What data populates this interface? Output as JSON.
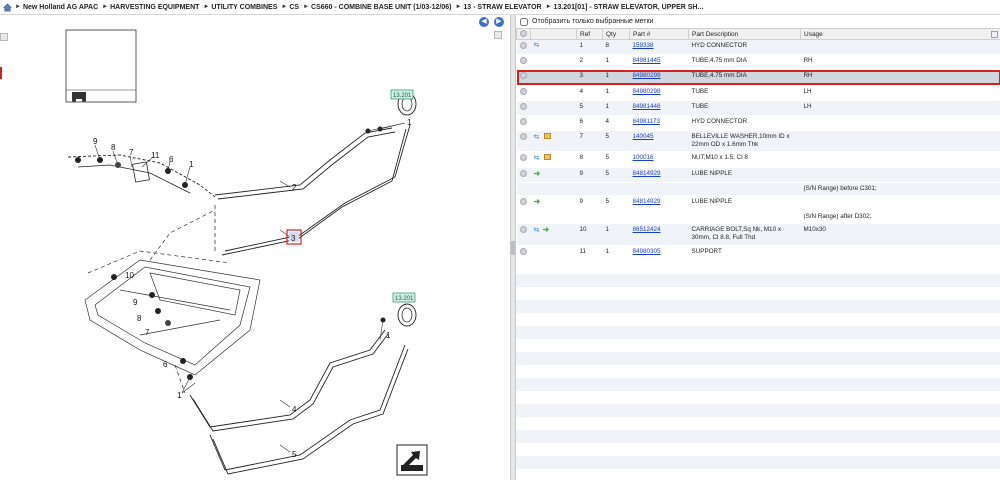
{
  "breadcrumb": {
    "items": [
      "New Holland AG APAC",
      "HARVESTING EQUIPMENT",
      "UTILITY COMBINES",
      "CS",
      "CS660 - COMBINE BASE UNIT (1/03-12/06)",
      "13 - STRAW ELEVATOR",
      "13.201[01] - STRAW ELEVATOR, UPPER SH..."
    ]
  },
  "diagram": {
    "ref_box_top": "13.201",
    "ref_box_bottom": "13.201",
    "callouts": [
      "1",
      "2",
      "3",
      "4",
      "5",
      "6",
      "7",
      "8",
      "9",
      "10",
      "11",
      "1",
      "1",
      "1",
      "6",
      "7",
      "8",
      "9",
      "10"
    ]
  },
  "filter": {
    "label": "Отобразить только выбранные метки"
  },
  "table": {
    "headers": [
      "Ref",
      "Qty",
      "Part #",
      "Part Description",
      "Usage"
    ],
    "rows": [
      {
        "ref": "1",
        "qty": "8",
        "part": "159338",
        "desc": "HYD CONNECTOR",
        "usage": "",
        "icons": [
          "swap"
        ]
      },
      {
        "ref": "2",
        "qty": "1",
        "part": "84981445",
        "desc": "TUBE,4.75 mm DIA",
        "usage": "RH",
        "icons": []
      },
      {
        "ref": "3",
        "qty": "1",
        "part": "84980299",
        "desc": "TUBE,4.75 mm DIA",
        "usage": "RH",
        "icons": [],
        "selected": true
      },
      {
        "ref": "4",
        "qty": "1",
        "part": "84980298",
        "desc": "TUBE",
        "usage": "LH",
        "icons": []
      },
      {
        "ref": "5",
        "qty": "1",
        "part": "84981446",
        "desc": "TUBE",
        "usage": "LH",
        "icons": []
      },
      {
        "ref": "6",
        "qty": "4",
        "part": "84981173",
        "desc": "HYD CONNECTOR",
        "usage": "",
        "icons": []
      },
      {
        "ref": "7",
        "qty": "5",
        "part": "140045",
        "desc": "BELLEVILLE WASHER,10mm ID x 22mm OD x 1.6mm Thk",
        "usage": "",
        "icons": [
          "swap",
          "box"
        ]
      },
      {
        "ref": "8",
        "qty": "5",
        "part": "100016",
        "desc": "NUT,M10 x 1.5, Cl 8",
        "usage": "",
        "icons": [
          "swap",
          "box"
        ]
      },
      {
        "ref": "9",
        "qty": "5",
        "part": "84814929",
        "desc": "LUBE NIPPLE",
        "usage": "",
        "icons": [
          "arrow"
        ],
        "note": "(S/N Range) before C301;"
      },
      {
        "ref": "9",
        "qty": "5",
        "part": "84814929",
        "desc": "LUBE NIPPLE",
        "usage": "",
        "icons": [
          "arrow"
        ],
        "note": "(S/N Range) after D302;"
      },
      {
        "ref": "10",
        "qty": "1",
        "part": "86512424",
        "desc": "CARRIAGE BOLT,Sq Nk, M10 x 30mm, Cl 8.8, Full Thd",
        "usage": "M10x30",
        "icons": [
          "swap",
          "arrow"
        ]
      },
      {
        "ref": "11",
        "qty": "1",
        "part": "84980305",
        "desc": "SUPPORT",
        "usage": "",
        "icons": []
      }
    ]
  },
  "colors": {
    "accent_blue": "#3a72c6",
    "selection_red": "#d62020",
    "link": "#1a3fcc",
    "callout_bg": "#cfeee4"
  }
}
